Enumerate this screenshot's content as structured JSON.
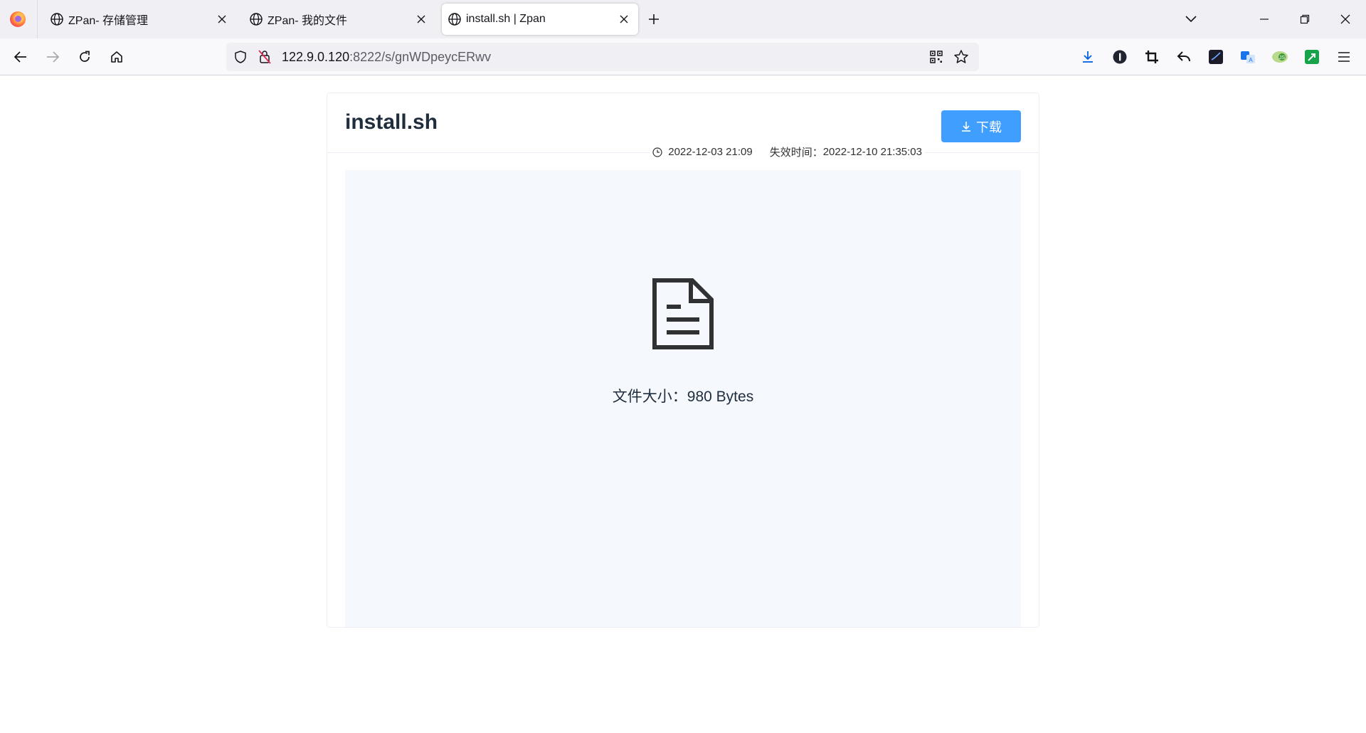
{
  "browser": {
    "tabs": [
      {
        "label": "ZPan- 存储管理",
        "active": false
      },
      {
        "label": "ZPan- 我的文件",
        "active": false
      },
      {
        "label": "install.sh | Zpan",
        "active": true
      }
    ],
    "url": {
      "host": "122.9.0.120",
      "path": ":8222/s/gnWDpeycERwv"
    }
  },
  "page": {
    "file_name": "install.sh",
    "download_label": "下载",
    "created_at": "2022-12-03 21:09",
    "expire_label": "失效时间：",
    "expire_at": "2022-12-10 21:35:03",
    "size_label": "文件大小：",
    "size_value": "980 Bytes"
  },
  "colors": {
    "accent": "#409eff",
    "preview_bg": "#f5f8fc"
  },
  "icons": [
    "firefox-icon",
    "globe-icon",
    "close-icon",
    "plus-icon",
    "chevron-down-icon",
    "minimize-icon",
    "restore-icon",
    "back-icon",
    "forward-icon",
    "reload-icon",
    "home-icon",
    "shield-icon",
    "lock-off-icon",
    "qr-icon",
    "star-icon",
    "download-icon",
    "document-icon",
    "clock-icon"
  ]
}
